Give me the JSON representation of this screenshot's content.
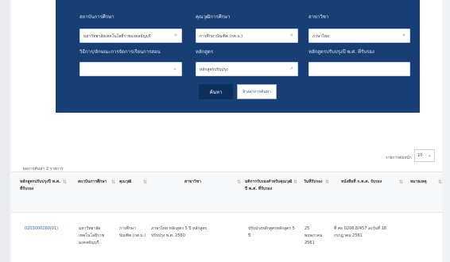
{
  "search_form": {
    "university": {
      "label": "สถาบันการศึกษา",
      "value": "มหาวิทยาลัยเทคโนโลยีราชมงคลธัญบุรี"
    },
    "degree": {
      "label": "คุณวุฒิการศึกษา",
      "value": "การศึกษาบัณฑิต (กศ.บ.)"
    },
    "major": {
      "label": "สาขาวิชา",
      "value": "ภาษาไทย"
    },
    "curriculum_type": {
      "label": "วิธีการ/ลักษณะการจัดการเรียนการสอน",
      "value": ""
    },
    "program": {
      "label": "หลักสูตร",
      "value": "หลักสูตรปรับปรุง"
    },
    "cert_year": {
      "label": "หลักสูตรปรับปรุงปี พ.ศ. ที่รับรอง",
      "value": ""
    },
    "search_button": "ค้นหา",
    "clear_button": "ล้างค่าการค้นหา"
  },
  "results": {
    "summary": "ผลการค้นหา 2 รายการ",
    "per_page_label": "รายการต่อหน้า",
    "per_page_value": "10"
  },
  "table": {
    "headers": [
      "หลักสูตรปรับปรุงปี พ.ศ. ที่รับรอง",
      "สถาบันการศึกษา",
      "คุณวุฒิ",
      "สาขาวิชา",
      "มติการรับรองสำหรับคุณวุฒิปี พ.ศ. ที่รับรอง",
      "วันที่รับรอง",
      "หนังสือที่ ก.พ.ศ. รับรอง",
      "หมายเหตุ"
    ],
    "rows": [
      {
        "id": "0203000260(01)",
        "university": "มหาวิทยาลัยเทคโนโลยีราชมงคลธัญบุรี",
        "degree": "การศึกษาบัณฑิต (กศ.บ.)",
        "major": "ภาษาไทย หลักสูตร 5 ปี หลักสูตรปรับปรุง พ.ศ. 2560",
        "resolution": "ปรับปรุงหลักสูตรหลักสูตร 5 ปี",
        "date": "25 พฤษภาคม 2561",
        "letter": "ที่ ศธ 0206.8/457 ลงวันที่ 18 กรกฎาคม 2561",
        "note": ""
      }
    ]
  },
  "colors": {
    "header_bg": "#173f73",
    "link": "#2366b8",
    "button_primary": "#0c2f5e"
  }
}
